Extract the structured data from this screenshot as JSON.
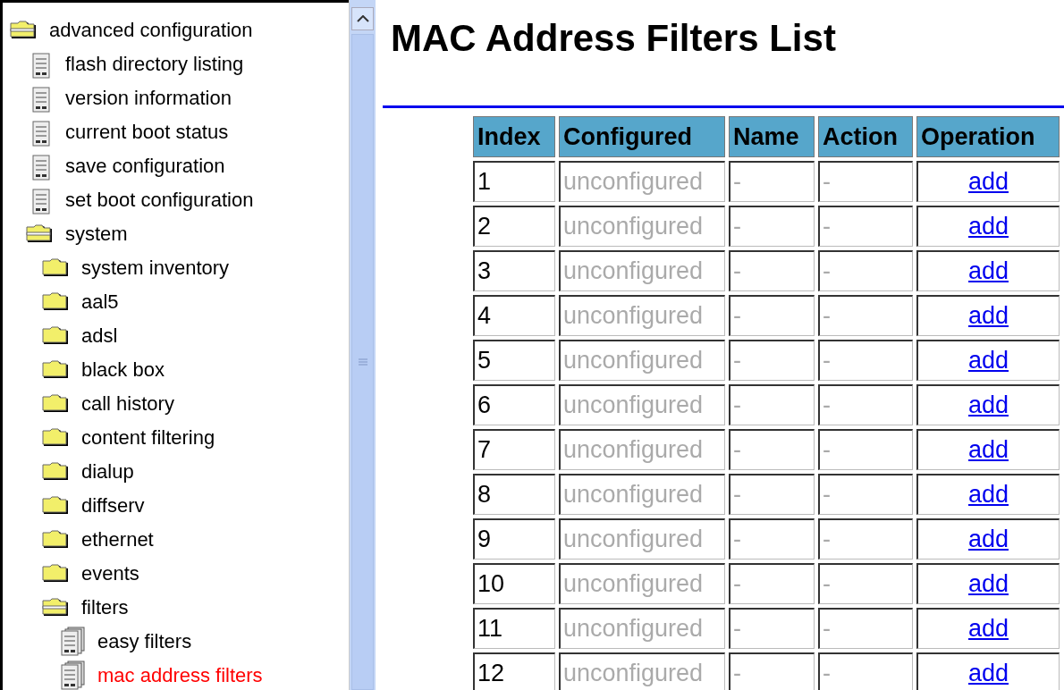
{
  "tree": [
    {
      "kind": "folder",
      "label": "advanced configuration",
      "expanded": true,
      "selected": false,
      "children": [
        {
          "kind": "page",
          "label": "flash directory listing",
          "selected": false
        },
        {
          "kind": "page",
          "label": "version information",
          "selected": false
        },
        {
          "kind": "page",
          "label": "current boot status",
          "selected": false
        },
        {
          "kind": "page",
          "label": "save configuration",
          "selected": false
        },
        {
          "kind": "page",
          "label": "set boot configuration",
          "selected": false
        },
        {
          "kind": "folder",
          "label": "system",
          "expanded": true,
          "selected": false,
          "children": [
            {
              "kind": "folder",
              "label": "system inventory",
              "expanded": false,
              "selected": false
            },
            {
              "kind": "folder",
              "label": "aal5",
              "expanded": false,
              "selected": false
            },
            {
              "kind": "folder",
              "label": "adsl",
              "expanded": false,
              "selected": false
            },
            {
              "kind": "folder",
              "label": "black box",
              "expanded": false,
              "selected": false
            },
            {
              "kind": "folder",
              "label": "call history",
              "expanded": false,
              "selected": false
            },
            {
              "kind": "folder",
              "label": "content filtering",
              "expanded": false,
              "selected": false
            },
            {
              "kind": "folder",
              "label": "dialup",
              "expanded": false,
              "selected": false
            },
            {
              "kind": "folder",
              "label": "diffserv",
              "expanded": false,
              "selected": false
            },
            {
              "kind": "folder",
              "label": "ethernet",
              "expanded": false,
              "selected": false
            },
            {
              "kind": "folder",
              "label": "events",
              "expanded": false,
              "selected": false
            },
            {
              "kind": "folder",
              "label": "filters",
              "expanded": true,
              "selected": false,
              "children": [
                {
                  "kind": "pages",
                  "label": "easy filters",
                  "selected": false
                },
                {
                  "kind": "pages",
                  "label": "mac address filters",
                  "selected": true
                }
              ]
            }
          ]
        }
      ]
    }
  ],
  "page": {
    "title": "MAC Address Filters List"
  },
  "table": {
    "columns": [
      "Index",
      "Configured",
      "Name",
      "Action",
      "Operation"
    ],
    "rows": [
      [
        "1",
        "unconfigured",
        "-",
        "-",
        "add"
      ],
      [
        "2",
        "unconfigured",
        "-",
        "-",
        "add"
      ],
      [
        "3",
        "unconfigured",
        "-",
        "-",
        "add"
      ],
      [
        "4",
        "unconfigured",
        "-",
        "-",
        "add"
      ],
      [
        "5",
        "unconfigured",
        "-",
        "-",
        "add"
      ],
      [
        "6",
        "unconfigured",
        "-",
        "-",
        "add"
      ],
      [
        "7",
        "unconfigured",
        "-",
        "-",
        "add"
      ],
      [
        "8",
        "unconfigured",
        "-",
        "-",
        "add"
      ],
      [
        "9",
        "unconfigured",
        "-",
        "-",
        "add"
      ],
      [
        "10",
        "unconfigured",
        "-",
        "-",
        "add"
      ],
      [
        "11",
        "unconfigured",
        "-",
        "-",
        "add"
      ],
      [
        "12",
        "unconfigured",
        "-",
        "-",
        "add"
      ]
    ]
  }
}
